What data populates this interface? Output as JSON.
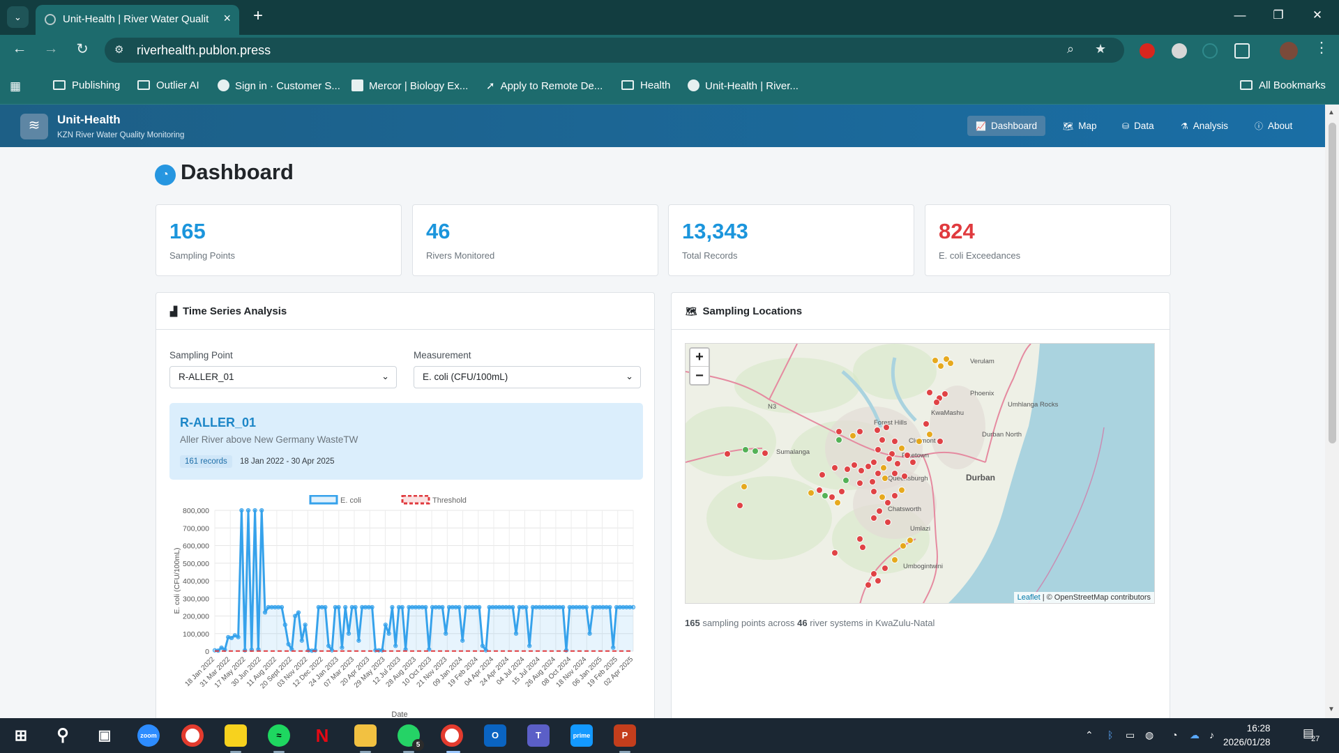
{
  "browser": {
    "tab_title": "Unit-Health | River Water Qualit",
    "url": "riverhealth.publon.press",
    "bookmarks": [
      "Publishing",
      "Outlier AI",
      "Sign in · Customer S...",
      "Mercor | Biology Ex...",
      "Apply to Remote De...",
      "Health",
      "Unit-Health | River..."
    ],
    "all_bookmarks": "All Bookmarks"
  },
  "app": {
    "brand": "Unit-Health",
    "subtitle": "KZN River Water Quality Monitoring",
    "nav": [
      "Dashboard",
      "Map",
      "Data",
      "Analysis",
      "About"
    ],
    "active_nav": "Dashboard"
  },
  "page": {
    "title": "Dashboard"
  },
  "stats": [
    {
      "value": "165",
      "label": "Sampling Points"
    },
    {
      "value": "46",
      "label": "Rivers Monitored"
    },
    {
      "value": "13,343",
      "label": "Total Records"
    },
    {
      "value": "824",
      "label": "E. coli Exceedances"
    }
  ],
  "timeseries": {
    "title": "Time Series Analysis",
    "sampling_point_label": "Sampling Point",
    "sampling_point_value": "R-ALLER_01",
    "measurement_label": "Measurement",
    "measurement_value": "E. coli (CFU/100mL)",
    "site_code": "R-ALLER_01",
    "site_desc": "Aller River above New Germany WasteTW",
    "records": "161 records",
    "date_range": "18 Jan 2022 - 30 Apr 2025"
  },
  "map": {
    "title": "Sampling Locations",
    "zoom_in": "+",
    "zoom_out": "−",
    "attribution_leaflet": "Leaflet",
    "attribution_rest": "| © OpenStreetMap contributors",
    "labels": [
      "Verulam",
      "Phoenix",
      "Umhlanga Rocks",
      "KwaMashu",
      "Durban North",
      "Forest Hills",
      "Clermont",
      "Pinetown",
      "Queensburgh",
      "Durban",
      "Chatsworth",
      "Umlazi",
      "Umbogintwini",
      "Sumalanga",
      "N3"
    ],
    "footer_points": "165",
    "footer_mid": " sampling points across ",
    "footer_rivers": "46",
    "footer_end": " river systems in KwaZulu-Natal"
  },
  "chart_data": {
    "type": "line",
    "title": "",
    "xlabel": "Date",
    "ylabel": "E. coli (CFU/100mL)",
    "ylim": [
      0,
      800000
    ],
    "yticks": [
      0,
      100000,
      200000,
      300000,
      400000,
      500000,
      600000,
      700000,
      800000
    ],
    "ytick_labels": [
      "0",
      "100,000",
      "200,000",
      "300,000",
      "400,000",
      "500,000",
      "600,000",
      "700,000",
      "800,000"
    ],
    "xtick_labels": [
      "18 Jan 2022",
      "31 Mar 2022",
      "17 May 2022",
      "30 Jun 2022",
      "11 Aug 2022",
      "20 Sept 2022",
      "03 Nov 2022",
      "12 Dec 2022",
      "24 Jan 2023",
      "07 Mar 2023",
      "20 Apr 2023",
      "29 May 2023",
      "12 Jul 2023",
      "28 Aug 2023",
      "10 Oct 2023",
      "21 Nov 2023",
      "09 Jan 2024",
      "19 Feb 2024",
      "04 Apr 2024",
      "24 Apr 2024",
      "04 Jul 2024",
      "15 Jul 2024",
      "26 Aug 2024",
      "08 Oct 2024",
      "18 Nov 2024",
      "06 Jan 2025",
      "19 Feb 2025",
      "02 Apr 2025"
    ],
    "legend": [
      "E. coli",
      "Threshold"
    ],
    "grid": true,
    "colors": {
      "ecoli": "#36a2eb",
      "threshold": "#e03a3e"
    },
    "series": [
      {
        "name": "E. coli",
        "values": [
          5000,
          3000,
          20000,
          8000,
          80000,
          75000,
          90000,
          80000,
          800000,
          5000,
          800000,
          8000,
          800000,
          10000,
          800000,
          220000,
          250000,
          250000,
          250000,
          250000,
          250000,
          150000,
          40000,
          10000,
          200000,
          220000,
          60000,
          150000,
          5000,
          3000,
          5000,
          250000,
          250000,
          250000,
          30000,
          5000,
          250000,
          250000,
          20000,
          250000,
          100000,
          250000,
          250000,
          60000,
          250000,
          250000,
          250000,
          250000,
          5000,
          5000,
          5000,
          150000,
          100000,
          250000,
          30000,
          250000,
          250000,
          10000,
          250000,
          250000,
          250000,
          250000,
          250000,
          250000,
          10000,
          250000,
          250000,
          250000,
          250000,
          100000,
          250000,
          250000,
          250000,
          250000,
          60000,
          250000,
          250000,
          250000,
          250000,
          250000,
          30000,
          5000,
          250000,
          250000,
          250000,
          250000,
          250000,
          250000,
          250000,
          250000,
          100000,
          250000,
          250000,
          250000,
          30000,
          250000,
          250000,
          250000,
          250000,
          250000,
          250000,
          250000,
          250000,
          250000,
          250000,
          5000,
          250000,
          250000,
          250000,
          250000,
          250000,
          250000,
          100000,
          250000,
          250000,
          250000,
          250000,
          250000,
          250000,
          20000,
          250000,
          250000,
          250000,
          250000,
          250000,
          250000
        ]
      },
      {
        "name": "Threshold",
        "values": [
          1000
        ]
      }
    ]
  },
  "taskbar": {
    "clock_time": "16:28",
    "clock_date": "2026/01/28",
    "notifications": "27",
    "whatsapp_badge": "5"
  }
}
